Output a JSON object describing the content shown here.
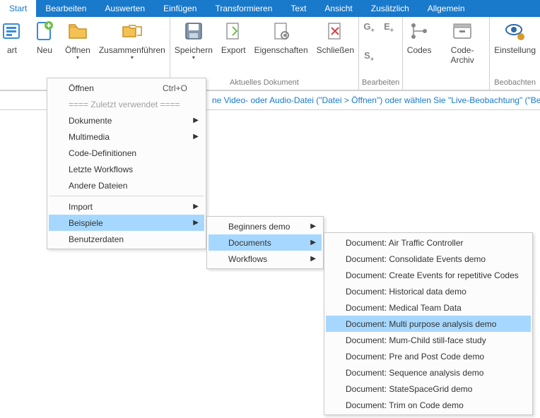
{
  "menubar": {
    "tabs": [
      "Start",
      "Bearbeiten",
      "Auswerten",
      "Einfügen",
      "Transformieren",
      "Text",
      "Ansicht",
      "Zusätzlich",
      "Allgemein"
    ],
    "active_index": 0
  },
  "ribbon": {
    "groups": [
      {
        "label": "",
        "buttons": [
          {
            "name": "art",
            "label": "art"
          },
          {
            "name": "neu",
            "label": "Neu"
          },
          {
            "name": "oeffnen",
            "label": "Öffnen",
            "dropdown": true
          },
          {
            "name": "zusammen",
            "label": "Zusammenführen",
            "dropdown": true
          }
        ]
      },
      {
        "label": "Aktuelles Dokument",
        "buttons": [
          {
            "name": "speichern",
            "label": "Speichern",
            "dropdown": true
          },
          {
            "name": "export",
            "label": "Export"
          },
          {
            "name": "eigenschaften",
            "label": "Eigenschaften"
          },
          {
            "name": "schliessen",
            "label": "Schließen"
          }
        ]
      },
      {
        "label": "Bearbeiten",
        "buttons": [
          {
            "name": "gplus",
            "label": ""
          },
          {
            "name": "eplus",
            "label": ""
          },
          {
            "name": "splus",
            "label": ""
          }
        ]
      },
      {
        "label": "",
        "buttons": [
          {
            "name": "codes",
            "label": "Codes"
          },
          {
            "name": "codearchiv",
            "label": "Code-Archiv"
          }
        ]
      },
      {
        "label": "Beobachten",
        "buttons": [
          {
            "name": "einstellung",
            "label": "Einstellung"
          }
        ]
      }
    ]
  },
  "hint": "ne Video- oder Audio-Datei (\"Datei > Öffnen\") oder wählen Sie \"Live-Beobachtung\" (\"Beo",
  "menu1": {
    "items": [
      {
        "label": "Öffnen",
        "shortcut": "Ctrl+O"
      },
      {
        "label": "==== Zuletzt verwendet ====",
        "disabled": true
      },
      {
        "label": "Dokumente",
        "submenu": true
      },
      {
        "label": "Multimedia",
        "submenu": true
      },
      {
        "label": "Code-Definitionen"
      },
      {
        "label": "Letzte Workflows"
      },
      {
        "label": "Andere Dateien"
      },
      {
        "sep": true
      },
      {
        "label": "Import",
        "submenu": true
      },
      {
        "label": "Beispiele",
        "submenu": true,
        "highlight": true
      },
      {
        "label": "Benutzerdaten"
      }
    ]
  },
  "menu2": {
    "items": [
      {
        "label": "Beginners demo",
        "submenu": true
      },
      {
        "label": "Documents",
        "submenu": true,
        "highlight": true
      },
      {
        "label": "Workflows",
        "submenu": true
      }
    ]
  },
  "menu3": {
    "items": [
      {
        "label": "Document: Air Traffic Controller"
      },
      {
        "label": "Document: Consolidate Events demo"
      },
      {
        "label": "Document: Create Events for repetitive Codes"
      },
      {
        "label": "Document: Historical data demo"
      },
      {
        "label": "Document: Medical Team Data"
      },
      {
        "label": "Document: Multi purpose analysis demo",
        "highlight": true
      },
      {
        "label": "Document: Mum-Child still-face study"
      },
      {
        "label": "Document: Pre and Post Code demo"
      },
      {
        "label": "Document: Sequence analysis demo"
      },
      {
        "label": "Document: StateSpaceGrid demo"
      },
      {
        "label": "Document: Trim on Code demo"
      }
    ]
  }
}
